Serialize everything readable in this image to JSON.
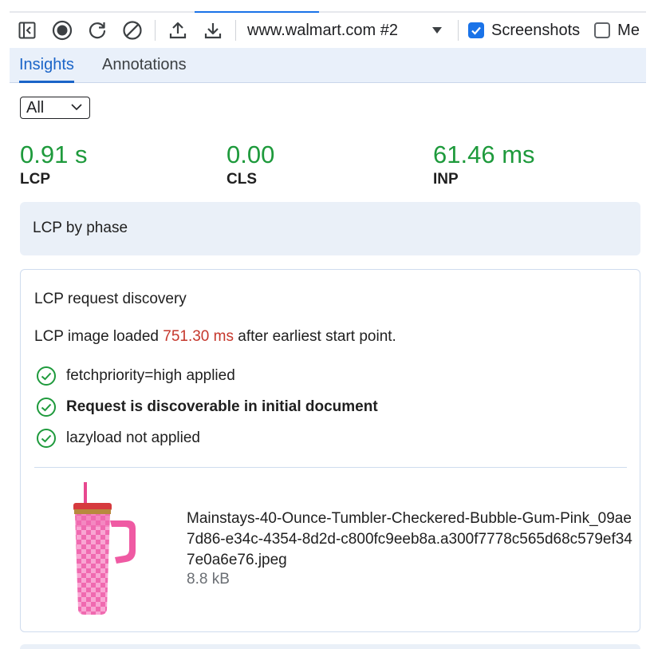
{
  "toolbar": {
    "url": "www.walmart.com #2",
    "screenshots_label": "Screenshots",
    "screenshots_checked": true,
    "memory_label": "Me",
    "memory_checked": false
  },
  "tabs": [
    {
      "label": "Insights",
      "active": true
    },
    {
      "label": "Annotations",
      "active": false
    }
  ],
  "filter": {
    "selected": "All"
  },
  "metrics": [
    {
      "value": "0.91 s",
      "label": "LCP"
    },
    {
      "value": "0.00",
      "label": "CLS"
    },
    {
      "value": "61.46 ms",
      "label": "INP"
    }
  ],
  "phase_card": {
    "title": "LCP by phase"
  },
  "discovery": {
    "title": "LCP request discovery",
    "summary_before": "LCP image loaded ",
    "summary_highlight": "751.30 ms",
    "summary_after": " after earliest start point.",
    "checks": [
      "fetchpriority=high applied",
      "Request is discoverable in initial document",
      "lazyload not applied"
    ],
    "file_name": "Mainstays-40-Ounce-Tumbler-Checkered-Bubble-Gum-Pink_09ae7d86-e34c-4354-8d2d-c800fc9eeb8a.a300f7778c565d68c579ef347e0a6e76.jpeg",
    "file_size": "8.8 kB"
  },
  "colors": {
    "accent": "#1a73e8",
    "good": "#1e9a3c",
    "highlight": "#c5372c"
  }
}
